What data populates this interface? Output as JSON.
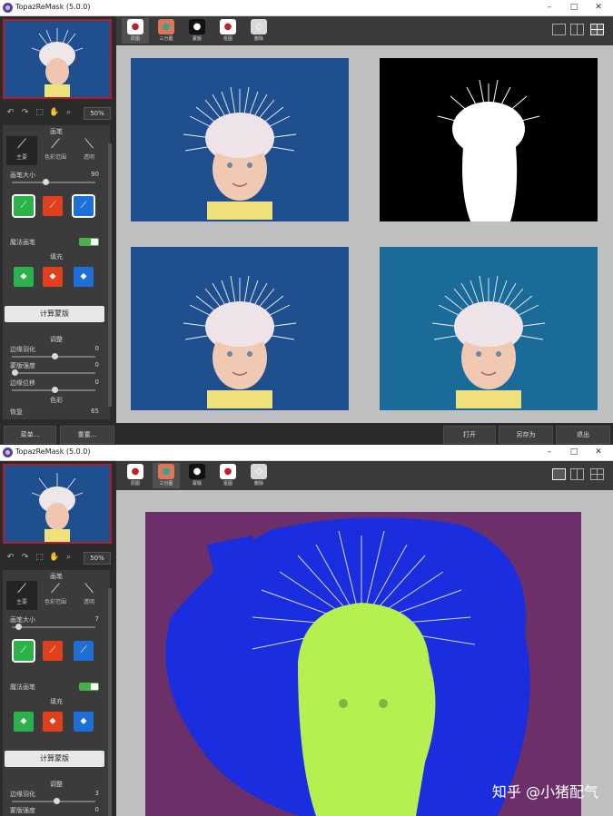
{
  "app": {
    "title": "TopazReMask (5.0.0)"
  },
  "window_controls": {
    "minimize": "–",
    "maximize": "□",
    "close": "✕"
  },
  "tools": {
    "zoom": "50%"
  },
  "brush": {
    "section_label": "画笔",
    "modes": [
      {
        "label": "主要"
      },
      {
        "label": "色彩范围"
      },
      {
        "label": "透明"
      }
    ],
    "size_label": "画笔大小",
    "size_value_1": "90",
    "size_value_2": "7",
    "magic_label": "魔法画笔"
  },
  "fill": {
    "section_label": "填充"
  },
  "compute_label": "计算蒙版",
  "adjust": {
    "section_label": "调整",
    "rows": [
      {
        "label": "边缘羽化",
        "value": "0"
      },
      {
        "label": "蒙版强度",
        "value": "0"
      },
      {
        "label": "边缘位移",
        "value": "0"
      }
    ],
    "feather_value_2": "3"
  },
  "color": {
    "section_label": "色彩",
    "restore_label": "恢复",
    "restore_value": "65"
  },
  "tabs": [
    {
      "label": "原图"
    },
    {
      "label": "三分图"
    },
    {
      "label": "蒙版"
    },
    {
      "label": "抠图"
    },
    {
      "label": "删除"
    }
  ],
  "bottom": {
    "menu": "菜单...",
    "reset": "重置...",
    "open": "打开",
    "save_as": "另存为",
    "exit": "退出"
  },
  "watermark": "知乎 @小猪配气",
  "colors": {
    "primary_blue": "#1f4f8f",
    "trimap_purple": "#6b2f6a",
    "trimap_blue": "#1a2ee0",
    "trimap_green": "#b5f050",
    "accent_red": "#b01e2a"
  }
}
